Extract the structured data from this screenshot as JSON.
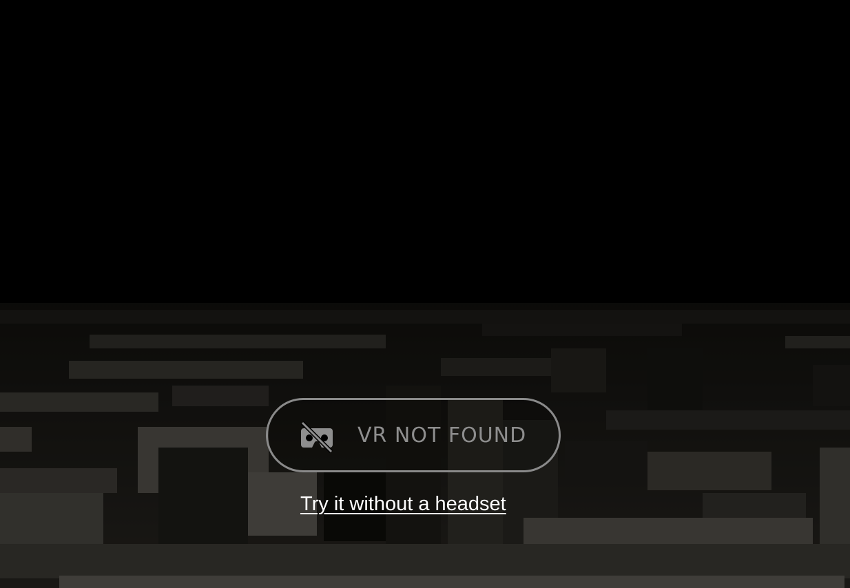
{
  "vr_button": {
    "label": "VR NOT FOUND",
    "icon": "vr-headset-off-icon"
  },
  "fallback_link": {
    "label": "Try it without a headset"
  },
  "colors": {
    "background": "#000000",
    "button_border": "#8a8a8a",
    "button_text": "#8e8e8e",
    "link_text": "#ffffff"
  }
}
